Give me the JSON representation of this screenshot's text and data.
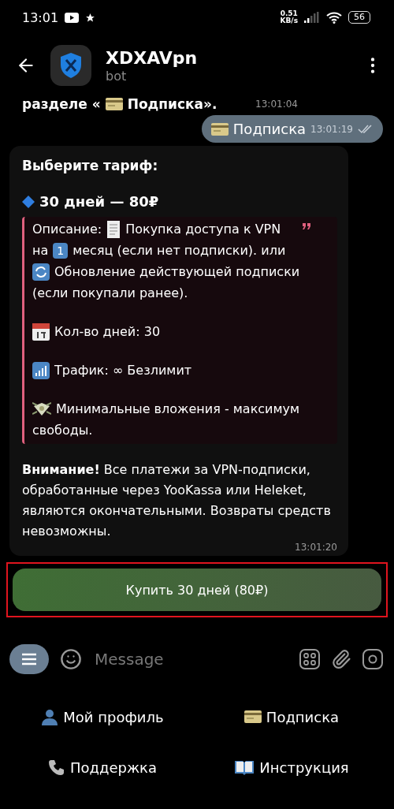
{
  "status_bar": {
    "time": "13:01",
    "net_speed": "0.51",
    "net_unit": "KB/s",
    "battery": "56"
  },
  "header": {
    "title": "XDXAVpn",
    "subtitle": "bot"
  },
  "previous_message": {
    "parts": [
      {
        "kind": "text",
        "text": "разделе «"
      },
      {
        "kind": "card"
      },
      {
        "kind": "text",
        "text": "Подписка»."
      }
    ],
    "time": "13:01:04"
  },
  "outgoing_message": {
    "parts": [
      {
        "kind": "card"
      },
      {
        "kind": "text",
        "text": "Подписка"
      }
    ],
    "time": "13:01:19",
    "read": true
  },
  "tariff_message": {
    "title": "Выберите тариф:",
    "plan": "30 дней — 80₽",
    "quote": [
      {
        "lines": [
          [
            {
              "kind": "text",
              "text": "Описание:"
            },
            {
              "kind": "receipt"
            },
            {
              "kind": "text",
              "text": "Покупка доступа к VPN"
            }
          ],
          [
            {
              "kind": "text",
              "text": "на"
            },
            {
              "kind": "keycap",
              "text": "1"
            },
            {
              "kind": "text",
              "text": "месяц (если нет подписки). или"
            }
          ],
          [
            {
              "kind": "refresh"
            },
            {
              "kind": "text",
              "text": "Обновление действующей подписки"
            }
          ],
          [
            {
              "kind": "text",
              "text": "(если покупали ранее)."
            }
          ]
        ]
      },
      {
        "lines": [
          [
            {
              "kind": "calendar"
            },
            {
              "kind": "text",
              "text": "Кол-во дней: 30"
            }
          ]
        ]
      },
      {
        "lines": [
          [
            {
              "kind": "chart"
            },
            {
              "kind": "text",
              "text": "Трафик: ∞ Безлимит"
            }
          ]
        ]
      },
      {
        "lines": [
          [
            {
              "kind": "money"
            },
            {
              "kind": "text",
              "text": "Минимальные вложения - максимум"
            }
          ],
          [
            {
              "kind": "text",
              "text": "свободы."
            }
          ]
        ]
      }
    ],
    "warning": "**Внимание!** Все платежи за VPN-подписки, обработанные через YooKassa или Heleket, являются окончательными. Возвраты средств невозможны.",
    "time": "13:01:20"
  },
  "inline_button": {
    "label": "Купить 30 дней (80₽)",
    "highlighted": true
  },
  "composer": {
    "placeholder": "Message"
  },
  "reply_keyboard": [
    {
      "kind": "person",
      "label": "Мой профиль"
    },
    {
      "kind": "card",
      "label": "Подписка"
    },
    {
      "kind": "phone",
      "label": "Поддержка"
    },
    {
      "kind": "book",
      "label": "Инструкция"
    }
  ]
}
